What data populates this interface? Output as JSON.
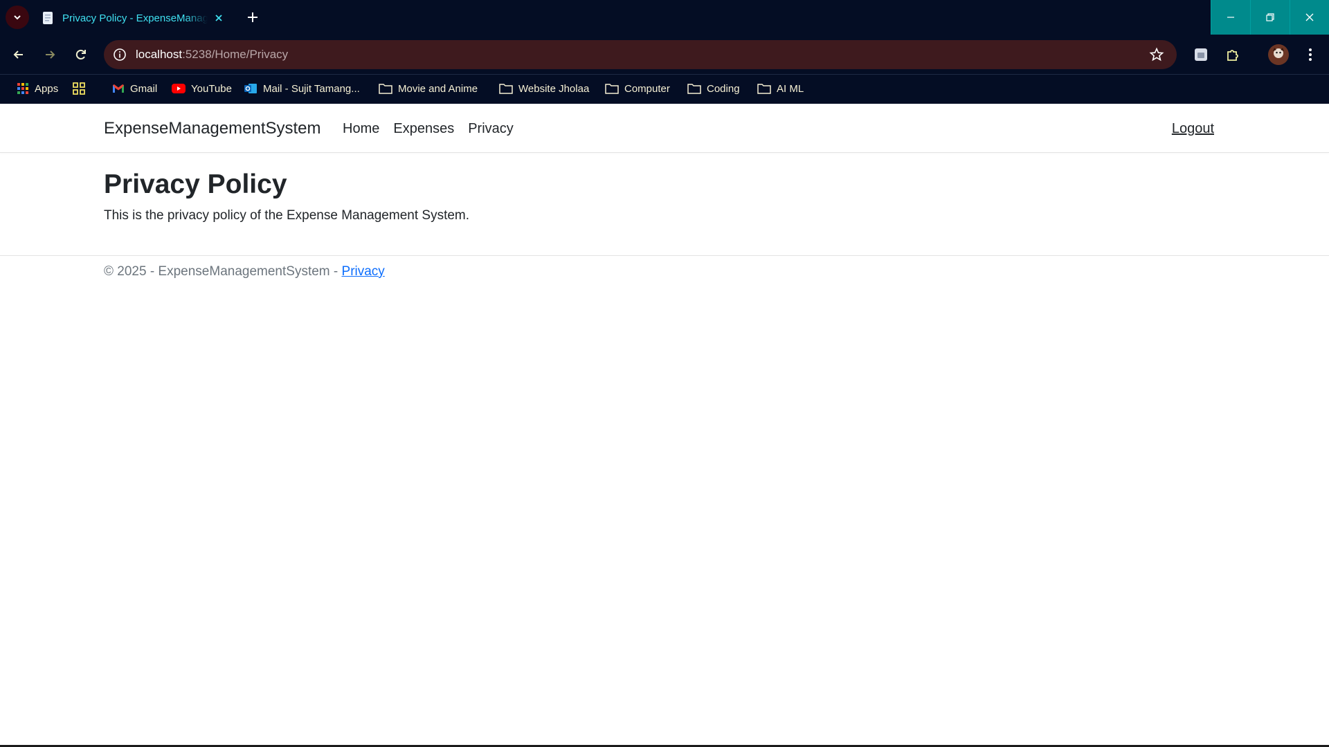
{
  "browser": {
    "tab_title": "Privacy Policy - ExpenseManagementSystem",
    "url_host": "localhost",
    "url_rest": ":5238/Home/Privacy",
    "bookmarks": [
      {
        "label": "Apps",
        "icon": "apps-grid-icon"
      },
      {
        "label": "Gmail",
        "icon": "gmail-icon"
      },
      {
        "label": "YouTube",
        "icon": "youtube-icon"
      },
      {
        "label": "Mail - Sujit Tamang...",
        "icon": "outlook-icon"
      },
      {
        "label": "Movie and Anime",
        "icon": "folder-icon"
      },
      {
        "label": "Website Jholaa",
        "icon": "folder-icon"
      },
      {
        "label": "Computer",
        "icon": "folder-icon"
      },
      {
        "label": "Coding",
        "icon": "folder-icon"
      },
      {
        "label": "AI ML",
        "icon": "folder-icon"
      }
    ],
    "colors": {
      "chrome_bg": "#040d24",
      "omnibox_bg": "#3e1a1e",
      "tab_text": "#3fe0f0",
      "window_buttons": "#008a8c"
    }
  },
  "site": {
    "brand": "ExpenseManagementSystem",
    "nav": [
      "Home",
      "Expenses",
      "Privacy"
    ],
    "logout": "Logout"
  },
  "content": {
    "heading": "Privacy Policy",
    "body": "This is the privacy policy of the Expense Management System."
  },
  "footer": {
    "text": "© 2025 - ExpenseManagementSystem - ",
    "link": "Privacy"
  }
}
